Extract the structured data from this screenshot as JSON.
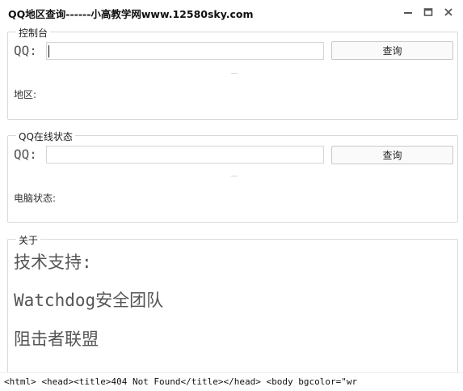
{
  "window": {
    "title": "QQ地区查询------小高教学网www.12580sky.com"
  },
  "console_group": {
    "legend": "控制台",
    "qq_label": "QQ:",
    "qq_input_value": "",
    "query_button": "查询",
    "region_label": "地区:"
  },
  "status_group": {
    "legend": "QQ在线状态",
    "qq_label": "QQ:",
    "qq_input_value": "",
    "query_button": "查询",
    "pc_status_label": "电脑状态:"
  },
  "about_group": {
    "legend": "关于",
    "lines": [
      "技术支持:",
      "Watchdog安全团队",
      "阻击者联盟"
    ]
  },
  "status_bar": {
    "text": "<html>  <head><title>404 Not Found</title></head>  <body bgcolor=\"wr"
  },
  "icons": {
    "minimize": "minimize-icon",
    "maximize": "maximize-icon",
    "close": "close-icon"
  }
}
